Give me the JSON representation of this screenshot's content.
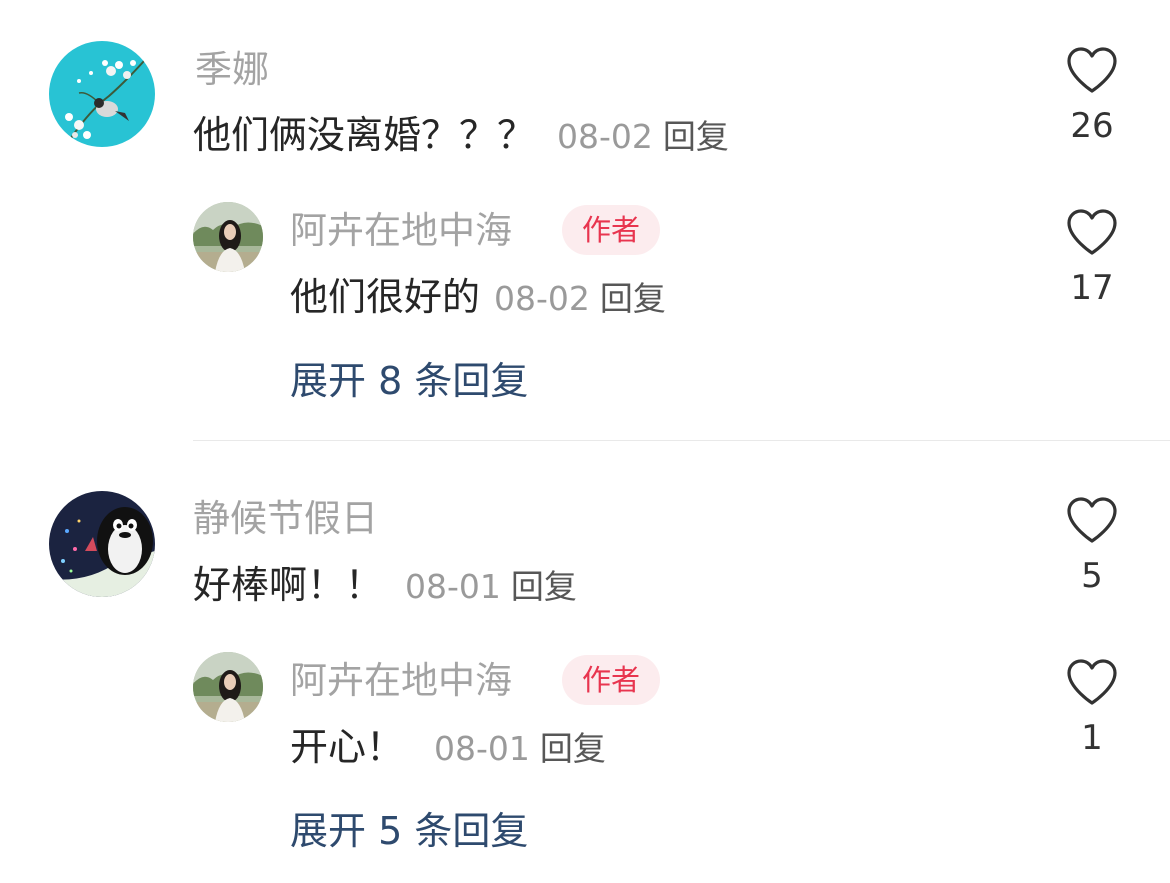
{
  "comments": [
    {
      "author": "季娜",
      "text": "他们俩没离婚？？？",
      "date": "08-02",
      "reply_label": "回复",
      "likes": "26",
      "avatar_icon": "bird-on-branch-avatar",
      "reply": {
        "author": "阿卉在地中海",
        "badge": "作者",
        "text": "他们很好的",
        "date": "08-02",
        "reply_label": "回复",
        "likes": "17",
        "avatar_icon": "woman-portrait-avatar"
      },
      "expand_label": "展开 8 条回复"
    },
    {
      "author": "静候节假日",
      "text": "好棒啊！！",
      "date": "08-01",
      "reply_label": "回复",
      "likes": "5",
      "avatar_icon": "penguin-avatar",
      "reply": {
        "author": "阿卉在地中海",
        "badge": "作者",
        "text": "开心！",
        "date": "08-01",
        "reply_label": "回复",
        "likes": "1",
        "avatar_icon": "woman-portrait-avatar"
      },
      "expand_label": "展开 5 条回复"
    }
  ],
  "colors": {
    "badge_bg": "#fcecee",
    "badge_text": "#e8354f",
    "expand_link": "#2e4a6e",
    "name_text": "#a3a3a3"
  }
}
